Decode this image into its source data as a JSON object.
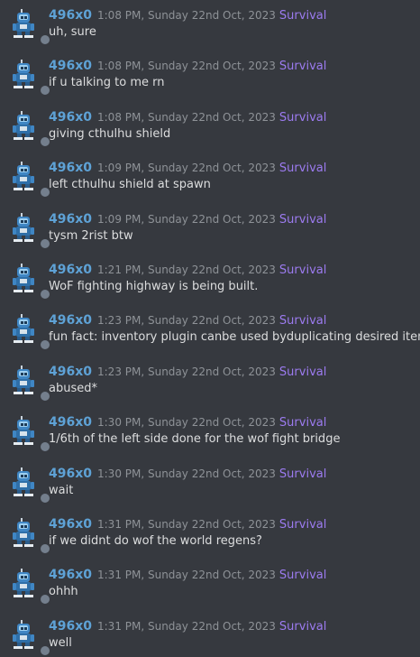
{
  "colors": {
    "background": "#36393f",
    "username": "#5ea2d6",
    "timestamp": "#8e9297",
    "tag": "#9c7bf0",
    "message_text": "#dcddde",
    "status_offline": "#747f8d"
  },
  "messages": [
    {
      "username": "496x0",
      "timestamp": "1:08 PM, Sunday 22nd Oct, 2023",
      "tag": "Survival",
      "text": "uh, sure"
    },
    {
      "username": "496x0",
      "timestamp": "1:08 PM, Sunday 22nd Oct, 2023",
      "tag": "Survival",
      "text": "if u talking to me rn"
    },
    {
      "username": "496x0",
      "timestamp": "1:08 PM, Sunday 22nd Oct, 2023",
      "tag": "Survival",
      "text": "giving cthulhu shield"
    },
    {
      "username": "496x0",
      "timestamp": "1:09 PM, Sunday 22nd Oct, 2023",
      "tag": "Survival",
      "text": "left cthulhu shield at spawn"
    },
    {
      "username": "496x0",
      "timestamp": "1:09 PM, Sunday 22nd Oct, 2023",
      "tag": "Survival",
      "text": "tysm 2rist btw"
    },
    {
      "username": "496x0",
      "timestamp": "1:21 PM, Sunday 22nd Oct, 2023",
      "tag": "Survival",
      "text": "WoF fighting highway is being built."
    },
    {
      "username": "496x0",
      "timestamp": "1:23 PM, Sunday 22nd Oct, 2023",
      "tag": "Survival",
      "text": "fun fact: inventory plugin canbe used byduplicating desired itemz"
    },
    {
      "username": "496x0",
      "timestamp": "1:23 PM, Sunday 22nd Oct, 2023",
      "tag": "Survival",
      "text": "abused*"
    },
    {
      "username": "496x0",
      "timestamp": "1:30 PM, Sunday 22nd Oct, 2023",
      "tag": "Survival",
      "text": "1/6th of the left side done for the wof fight bridge"
    },
    {
      "username": "496x0",
      "timestamp": "1:30 PM, Sunday 22nd Oct, 2023",
      "tag": "Survival",
      "text": "wait"
    },
    {
      "username": "496x0",
      "timestamp": "1:31 PM, Sunday 22nd Oct, 2023",
      "tag": "Survival",
      "text": "if we didnt do wof the world regens?"
    },
    {
      "username": "496x0",
      "timestamp": "1:31 PM, Sunday 22nd Oct, 2023",
      "tag": "Survival",
      "text": "ohhh"
    },
    {
      "username": "496x0",
      "timestamp": "1:31 PM, Sunday 22nd Oct, 2023",
      "tag": "Survival",
      "text": "well"
    }
  ]
}
